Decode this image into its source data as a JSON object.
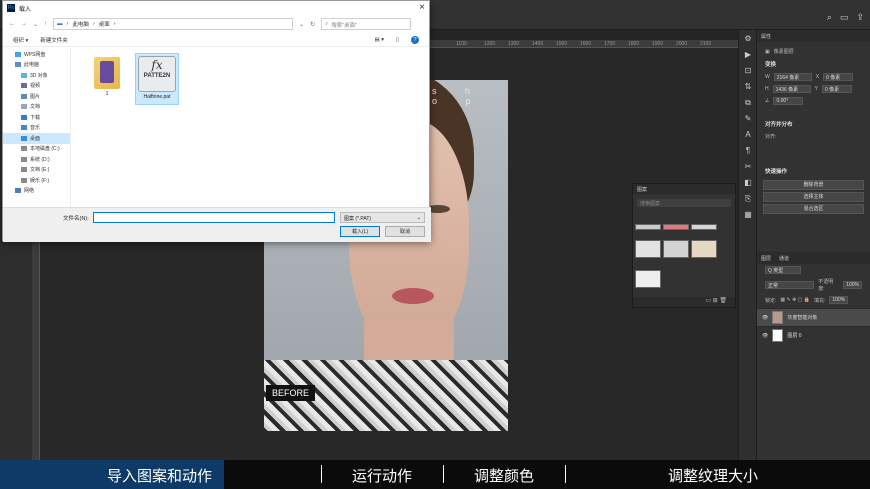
{
  "photoshop": {
    "rulers": [
      "1100",
      "1200",
      "1300",
      "1400",
      "1500",
      "1600",
      "1700",
      "1800",
      "1900",
      "2000",
      "2100"
    ],
    "top_right_icons": [
      "search-icon",
      "workspace-icon",
      "share-icon"
    ],
    "photo": {
      "overlay_text": "s h o p",
      "badge": "BEFORE"
    }
  },
  "pattern_panel": {
    "title": "图案",
    "search_placeholder": "搜索图案",
    "swatches": [
      "#c9c9c9",
      "#e07a7a",
      "#d6d6d6",
      "#e2e2e2",
      "#d3d3d3",
      "#e5d9c2",
      "#eeeeee"
    ]
  },
  "properties": {
    "tab": "属性",
    "doc_label": "像素图层",
    "transform_title": "变换",
    "w": "2164 像素",
    "x": "0 像素",
    "h": "1436 像素",
    "y": "0 像素",
    "angle": "0.00°",
    "align_title": "对齐并分布",
    "align_label": "对齐:",
    "quick_title": "快速操作",
    "quick_actions": [
      "删除背景",
      "选择主体",
      "混合选区"
    ]
  },
  "layers": {
    "tabs": [
      "图层",
      "通道"
    ],
    "filter": "Q 类型",
    "blend": "正常",
    "opacity_label": "不透明度:",
    "opacity": "100%",
    "lock_label": "锁定:",
    "fill_label": "填充:",
    "fill": "100%",
    "items": [
      {
        "name": "灰度智能对象",
        "selected": true
      },
      {
        "name": "图层 0",
        "selected": false
      }
    ]
  },
  "dialog": {
    "title": "载入",
    "breadcrumb": [
      "此电脑",
      "桌面"
    ],
    "search_placeholder": "搜索\"桌面\"",
    "cmd": [
      "组织 ▾",
      "新建文件夹"
    ],
    "sidebar": [
      {
        "label": "WPS网盘",
        "level": "root"
      },
      {
        "label": "此电脑",
        "level": "root"
      },
      {
        "label": "3D 对象",
        "level": "child"
      },
      {
        "label": "视频",
        "level": "child"
      },
      {
        "label": "图片",
        "level": "child"
      },
      {
        "label": "文档",
        "level": "child"
      },
      {
        "label": "下载",
        "level": "child"
      },
      {
        "label": "音乐",
        "level": "child"
      },
      {
        "label": "桌面",
        "level": "child",
        "selected": true
      },
      {
        "label": "本地磁盘 (C:)",
        "level": "child"
      },
      {
        "label": "系统 (D:)",
        "level": "child"
      },
      {
        "label": "文档 (E:)",
        "level": "child"
      },
      {
        "label": "娱乐 (F:)",
        "level": "child"
      },
      {
        "label": "网络",
        "level": "root"
      }
    ],
    "files": [
      {
        "name": "1",
        "type": "folder"
      },
      {
        "name": "Halftone.pat",
        "type": "pattern",
        "icon_fx": "fx",
        "icon_text": "PATTE2N"
      }
    ],
    "filename_label": "文件名(N):",
    "filename_value": "",
    "filetype": "图案 (*.PAT)",
    "open_label": "载入(L)",
    "cancel_label": "取消"
  },
  "captions": [
    "导入图案和动作",
    "运行动作",
    "调整颜色",
    "调整纹理大小"
  ]
}
